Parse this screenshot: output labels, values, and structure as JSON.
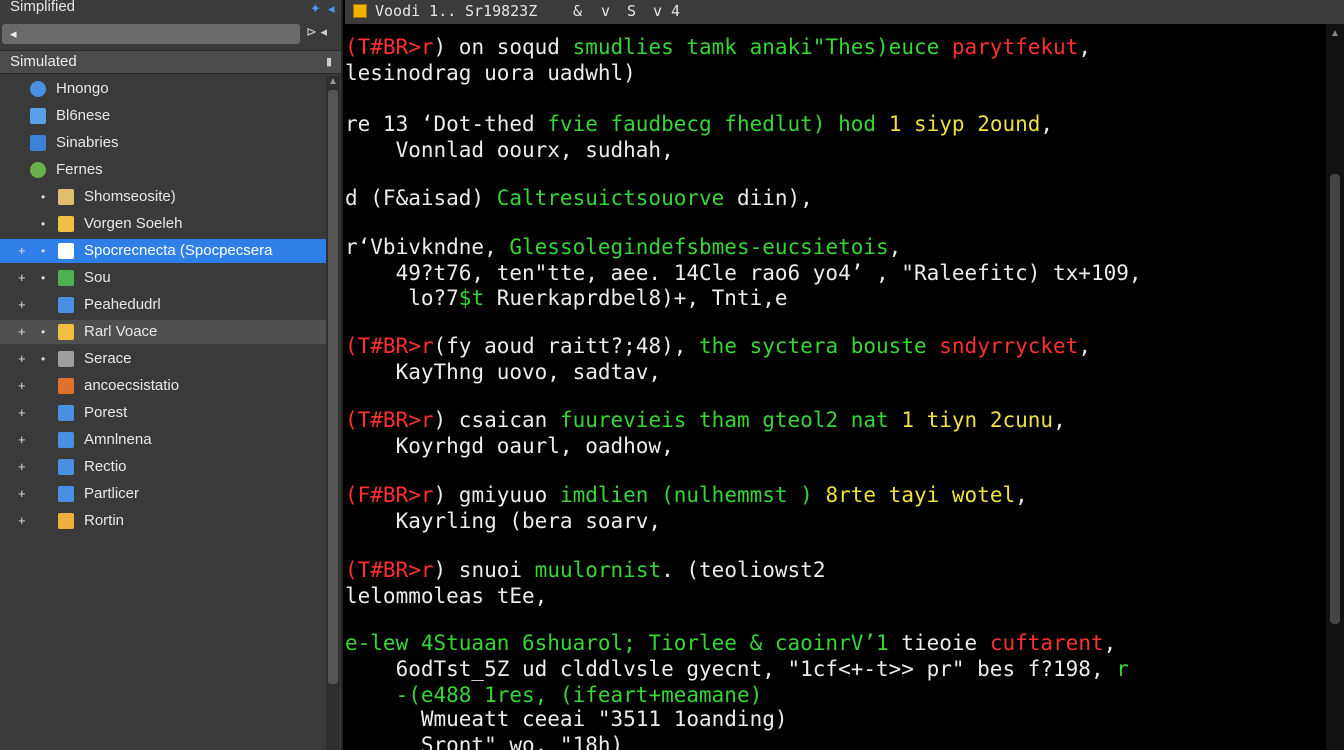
{
  "sidebar": {
    "title": "Simplified",
    "title_controls": [
      "✦",
      "◂"
    ],
    "search_placeholder": "◂",
    "search_controls": "⊳ ◂",
    "header": "Simulated",
    "header_pin": "▮",
    "items": [
      {
        "label": "Hnongo",
        "icon": "globe-icon",
        "color": "#4a90e2",
        "expander": "",
        "expander2": "",
        "state": ""
      },
      {
        "label": "Bl6nese",
        "icon": "document-icon",
        "color": "#5aa0e8",
        "expander": "",
        "expander2": "",
        "state": ""
      },
      {
        "label": "Sinabries",
        "icon": "window-icon",
        "color": "#3b82d6",
        "expander": "",
        "expander2": "",
        "state": ""
      },
      {
        "label": "Fernes",
        "icon": "leaf-icon",
        "color": "#6ab04c",
        "expander": "",
        "expander2": "",
        "state": ""
      },
      {
        "label": "Shomseosite)",
        "icon": "folder-icon",
        "color": "#e0c070",
        "expander": "",
        "expander2": "•",
        "state": ""
      },
      {
        "label": "Vorgen Soeleh",
        "icon": "folder-icon",
        "color": "#f0c040",
        "expander": "",
        "expander2": "•",
        "state": ""
      },
      {
        "label": "Spocrecnecta (Spocpecsera",
        "icon": "edit-icon",
        "color": "#ffffff",
        "expander": "+",
        "expander2": "•",
        "state": "selected"
      },
      {
        "label": "Sou",
        "icon": "grid-icon",
        "color": "#4caf50",
        "expander": "+",
        "expander2": "•",
        "state": ""
      },
      {
        "label": "Peahedudrl",
        "icon": "document-icon",
        "color": "#4a90e2",
        "expander": "+",
        "expander2": "",
        "state": ""
      },
      {
        "label": "Rarl Voace",
        "icon": "folder-icon",
        "color": "#f0c040",
        "expander": "+",
        "expander2": "•",
        "state": "hovered"
      },
      {
        "label": "Serace",
        "icon": "list-icon",
        "color": "#9e9e9e",
        "expander": "+",
        "expander2": "•",
        "state": ""
      },
      {
        "label": "ancoecsistatio",
        "icon": "puzzle-icon",
        "color": "#e07030",
        "expander": "+",
        "expander2": "",
        "state": ""
      },
      {
        "label": "Porest",
        "icon": "image-icon",
        "color": "#4a90e2",
        "expander": "+",
        "expander2": "",
        "state": ""
      },
      {
        "label": "Amnlnena",
        "icon": "monitor-icon",
        "color": "#4a90e2",
        "expander": "+",
        "expander2": "",
        "state": ""
      },
      {
        "label": "Rectio",
        "icon": "window-icon",
        "color": "#4a90e2",
        "expander": "+",
        "expander2": "",
        "state": ""
      },
      {
        "label": "Partlicer",
        "icon": "window-icon",
        "color": "#4a90e2",
        "expander": "+",
        "expander2": "",
        "state": ""
      },
      {
        "label": "Rortin",
        "icon": "card-icon",
        "color": "#f0b040",
        "expander": "+",
        "expander2": "",
        "state": ""
      }
    ]
  },
  "editor": {
    "tab_parts": [
      "Voodi 1..",
      "Sr19823Z",
      "&",
      "v",
      "S",
      "v 4"
    ],
    "lines": [
      {
        "segs": [
          {
            "t": "(T#BR>r",
            "c": "red"
          },
          {
            "t": ") on soqud ",
            "c": "wht"
          },
          {
            "t": "smudlies tamk anaki\"Thes)euce",
            "c": "grn"
          },
          {
            "t": " ",
            "c": "wht"
          },
          {
            "t": "parytfekut",
            "c": "red"
          },
          {
            "t": ",",
            "c": "wht"
          }
        ]
      },
      {
        "segs": [
          {
            "t": "lesinodrag uora uadwhl)",
            "c": "wht"
          }
        ]
      },
      {
        "segs": [
          {
            "t": "re 13 ‘Dot-thed ",
            "c": "wht"
          },
          {
            "t": "fvie faudbecg fhedlut) hod",
            "c": "grn"
          },
          {
            "t": " ",
            "c": "wht"
          },
          {
            "t": "1 siyp 2ound",
            "c": "yel"
          },
          {
            "t": ",",
            "c": "wht"
          }
        ]
      },
      {
        "segs": [
          {
            "t": "    Vonnlad oourx, sudhah,",
            "c": "wht"
          }
        ]
      },
      {
        "segs": [
          {
            "t": "d (F&aisad) ",
            "c": "wht"
          },
          {
            "t": "Caltresuictsouorve",
            "c": "grn"
          },
          {
            "t": " diin),",
            "c": "wht"
          }
        ]
      },
      {
        "segs": [
          {
            "t": "r‘Vbivkndne, ",
            "c": "wht"
          },
          {
            "t": "Glessolegindefsbmes-eucsietois",
            "c": "grn"
          },
          {
            "t": ",",
            "c": "wht"
          }
        ]
      },
      {
        "segs": [
          {
            "t": "    49?t76, ten\"tte, aee. 14Cle rao6 yo4’ , \"Raleefitc) tx+109,",
            "c": "wht"
          }
        ]
      },
      {
        "segs": [
          {
            "t": "     lo?7",
            "c": "wht"
          },
          {
            "t": "$t",
            "c": "grn"
          },
          {
            "t": " Ruerkaprdbel8)+, Tnti,e",
            "c": "wht"
          }
        ]
      },
      {
        "segs": [
          {
            "t": "(T#BR>r",
            "c": "red"
          },
          {
            "t": "(fy aoud raitt?;48), ",
            "c": "wht"
          },
          {
            "t": "the syctera bouste",
            "c": "grn"
          },
          {
            "t": " ",
            "c": "wht"
          },
          {
            "t": "sndyrrycket",
            "c": "red"
          },
          {
            "t": ",",
            "c": "wht"
          }
        ]
      },
      {
        "segs": [
          {
            "t": "    KayThng uovo, sadtav,",
            "c": "wht"
          }
        ]
      },
      {
        "segs": [
          {
            "t": "(T#BR>r",
            "c": "red"
          },
          {
            "t": ") csaican ",
            "c": "wht"
          },
          {
            "t": "fuurevieis tham gteol2 nat",
            "c": "grn"
          },
          {
            "t": " ",
            "c": "wht"
          },
          {
            "t": "1 tiyn 2cunu",
            "c": "yel"
          },
          {
            "t": ",",
            "c": "wht"
          }
        ]
      },
      {
        "segs": [
          {
            "t": "    Koyrhgd oaurl, oadhow,",
            "c": "wht"
          }
        ]
      },
      {
        "segs": [
          {
            "t": "(F#BR>r",
            "c": "red"
          },
          {
            "t": ") gmiyuuo ",
            "c": "wht"
          },
          {
            "t": "imdlien (nulhemmst ) ",
            "c": "grn"
          },
          {
            "t": "8rte tayi wotel",
            "c": "yel"
          },
          {
            "t": ",",
            "c": "wht"
          }
        ]
      },
      {
        "segs": [
          {
            "t": "    Kayrling (bera soarv,",
            "c": "wht"
          }
        ]
      },
      {
        "segs": [
          {
            "t": "(T#BR>r",
            "c": "red"
          },
          {
            "t": ") snuoi ",
            "c": "wht"
          },
          {
            "t": "muulornist",
            "c": "grn"
          },
          {
            "t": ". (teoliowst2",
            "c": "wht"
          }
        ]
      },
      {
        "segs": [
          {
            "t": "lelommoleas tEe,",
            "c": "wht"
          }
        ]
      },
      {
        "segs": [
          {
            "t": "e-lew 4Stuaan 6shuarol; Tiorlee & caoinrV’1",
            "c": "grn"
          },
          {
            "t": " tieoie ",
            "c": "wht"
          },
          {
            "t": "cuftarent",
            "c": "red"
          },
          {
            "t": ",",
            "c": "wht"
          }
        ]
      },
      {
        "segs": [
          {
            "t": "    6odTst_5Z ud clddlvsle gyecnt, \"1cf<+-t>> pr\" bes f?198, ",
            "c": "wht"
          },
          {
            "t": "r",
            "c": "grn"
          }
        ]
      },
      {
        "segs": [
          {
            "t": "    ",
            "c": "wht"
          },
          {
            "t": "-(e488 1res, (ifeart+meamane)",
            "c": "grn"
          }
        ]
      },
      {
        "segs": [
          {
            "t": "      Wmueatt ceeai \"3511 1oanding)",
            "c": "wht"
          }
        ]
      },
      {
        "segs": [
          {
            "t": "      Sront\" wo, \"18h)",
            "c": "wht"
          }
        ]
      }
    ]
  }
}
